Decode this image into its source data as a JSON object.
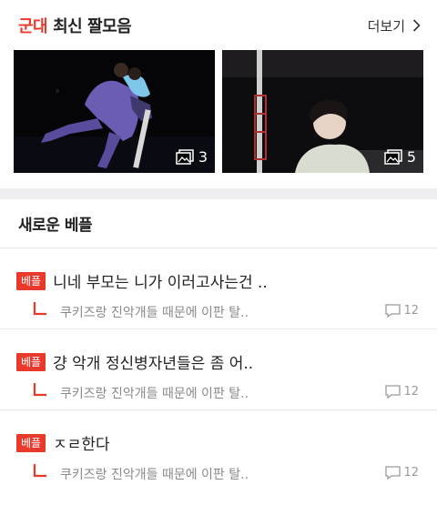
{
  "header": {
    "accent": "군대",
    "title": "최신 짤모음",
    "more_label": "더보기"
  },
  "thumbnails": [
    {
      "count": "3",
      "icon": "gallery-icon"
    },
    {
      "count": "5",
      "icon": "gallery-icon"
    }
  ],
  "section2": {
    "title": "새로운 베플"
  },
  "posts": [
    {
      "badge": "베플",
      "title": "니네 부모는 니가 이러고사는건 ..",
      "reply": "쿠키즈랑 진악개들 때문에 이판 탈..",
      "comments": "12"
    },
    {
      "badge": "베플",
      "title": "걍 악개 정신병자년들은 좀 어..",
      "reply": "쿠키즈랑 진악개들 때문에 이판 탈..",
      "comments": "12"
    },
    {
      "badge": "베플",
      "title": "ㅈㄹ한다",
      "reply": "쿠키즈랑 진악개들 때문에 이판 탈..",
      "comments": "12"
    }
  ],
  "colors": {
    "accent": "#e8392b",
    "band": "#eeeef0"
  }
}
